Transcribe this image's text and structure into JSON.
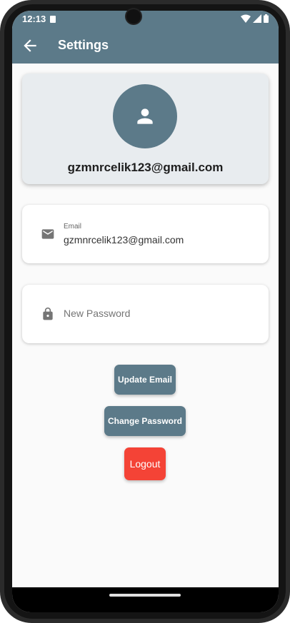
{
  "status_bar": {
    "time": "12:13",
    "icons": [
      "sim-card-icon",
      "wifi-icon",
      "signal-icon",
      "battery-icon"
    ]
  },
  "app_bar": {
    "title": "Settings",
    "back_icon": "arrow-back-icon",
    "color": "#5c7a89"
  },
  "profile": {
    "avatar_icon": "person-icon",
    "email": "gzmnrcelik123@gmail.com"
  },
  "email_field": {
    "icon": "mail-icon",
    "label": "Email",
    "value": "gzmnrcelik123@gmail.com"
  },
  "password_field": {
    "icon": "lock-icon",
    "placeholder": "New Password",
    "value": ""
  },
  "buttons": {
    "update_email": "Update Email",
    "change_password": "Change Password",
    "logout": "Logout"
  },
  "colors": {
    "primary": "#5c7a89",
    "danger": "#f44336",
    "background": "#fafafa"
  }
}
